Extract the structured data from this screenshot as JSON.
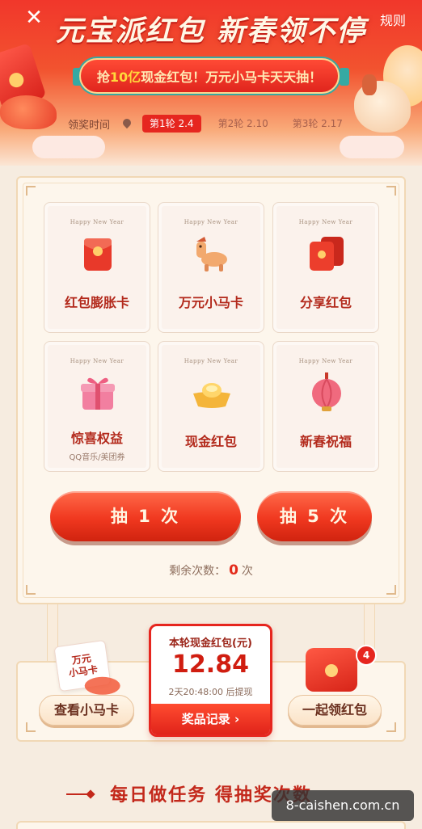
{
  "header": {
    "close_glyph": "✕",
    "title": "元宝派红包 新春领不停",
    "rules_label": "规则",
    "slogan_prefix": "抢",
    "slogan_highlight": "10亿",
    "slogan_suffix": "现金红包！万元小马卡天天抽！",
    "time_label": "领奖时间",
    "rounds": [
      {
        "label": "第1轮 2.4",
        "active": true
      },
      {
        "label": "第2轮 2.10",
        "active": false
      },
      {
        "label": "第3轮 2.17",
        "active": false
      }
    ]
  },
  "prizes": [
    {
      "happy": "Happy New Year",
      "name": "红包膨胀卡",
      "sub": "",
      "icon": "red-envelope-icon"
    },
    {
      "happy": "Happy New Year",
      "name": "万元小马卡",
      "sub": "",
      "icon": "pony-icon"
    },
    {
      "happy": "Happy New Year",
      "name": "分享红包",
      "sub": "",
      "icon": "twin-envelopes-icon"
    },
    {
      "happy": "Happy New Year",
      "name": "惊喜权益",
      "sub": "QQ音乐/美团券",
      "icon": "gift-box-icon"
    },
    {
      "happy": "Happy New Year",
      "name": "现金红包",
      "sub": "",
      "icon": "gold-ingot-icon"
    },
    {
      "happy": "Happy New Year",
      "name": "新春祝福",
      "sub": "",
      "icon": "lantern-icon"
    }
  ],
  "draw": {
    "once_label": "抽 1 次",
    "five_label": "抽 5 次",
    "remain_prefix": "剩余次数：",
    "remain_count": "0",
    "remain_suffix": "次"
  },
  "cash": {
    "title": "本轮现金红包(元)",
    "amount": "12.84",
    "deadline": "2天20:48:00 后提现",
    "record_label": "奖品记录 ›"
  },
  "side_buttons": {
    "view_card_label": "查看小马卡",
    "collect_label": "一起领红包",
    "horse_card_line1": "万元",
    "horse_card_line2": "小马卡",
    "badge_count": "4"
  },
  "tasks": {
    "heading": "每日做任务 得抽奖次数"
  },
  "watermark": "8-caishen.com.cn",
  "colors": {
    "brand_red": "#e6261f",
    "cream": "#fdf6ec",
    "gold_border": "#f1d8b5"
  }
}
